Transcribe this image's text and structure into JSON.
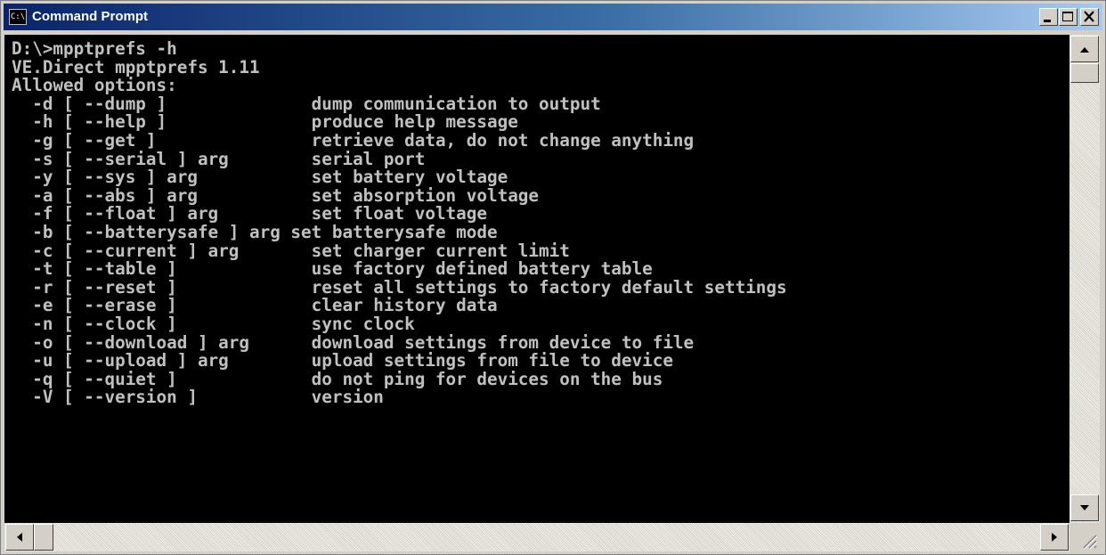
{
  "window": {
    "title": "Command Prompt",
    "icon_label": "C:\\",
    "icon": "console-icon"
  },
  "console": {
    "lines": [
      "D:\\>mpptprefs -h",
      "VE.Direct mpptprefs 1.11",
      "Allowed options:",
      "  -d [ --dump ]              dump communication to output",
      "  -h [ --help ]              produce help message",
      "  -g [ --get ]               retrieve data, do not change anything",
      "  -s [ --serial ] arg        serial port",
      "  -y [ --sys ] arg           set battery voltage",
      "  -a [ --abs ] arg           set absorption voltage",
      "  -f [ --float ] arg         set float voltage",
      "  -b [ --batterysafe ] arg set batterysafe mode",
      "  -c [ --current ] arg       set charger current limit",
      "  -t [ --table ]             use factory defined battery table",
      "  -r [ --reset ]             reset all settings to factory default settings",
      "  -e [ --erase ]             clear history data",
      "  -n [ --clock ]             sync clock",
      "  -o [ --download ] arg      download settings from device to file",
      "  -u [ --upload ] arg        upload settings from file to device",
      "  -q [ --quiet ]             do not ping for devices on the bus",
      "  -V [ --version ]           version"
    ],
    "text_color": "#c0c0c0",
    "background": "#000000"
  },
  "controls": {
    "minimize": "minimize-icon",
    "maximize": "maximize-icon",
    "close": "close-icon"
  }
}
